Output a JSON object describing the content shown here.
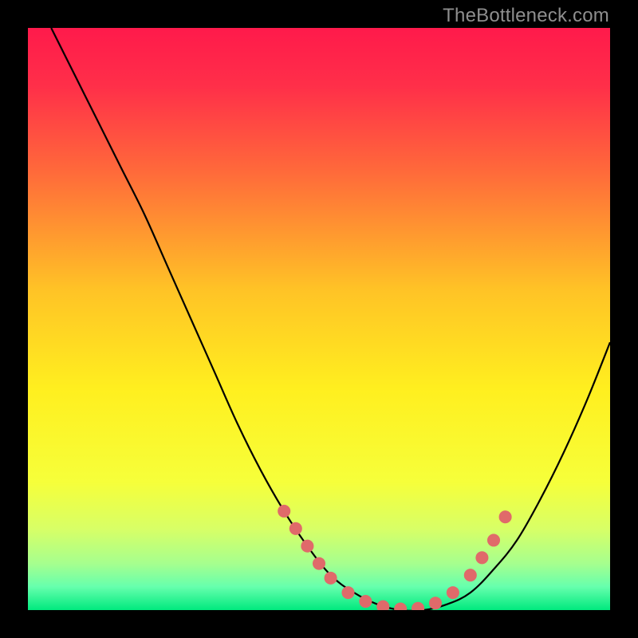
{
  "attribution": "TheBottleneck.com",
  "chart_data": {
    "type": "line",
    "title": "",
    "xlabel": "",
    "ylabel": "",
    "xlim": [
      0,
      100
    ],
    "ylim": [
      0,
      100
    ],
    "gradient_stops": [
      {
        "offset": 0.0,
        "color": "#ff1a4b"
      },
      {
        "offset": 0.1,
        "color": "#ff2f49"
      },
      {
        "offset": 0.25,
        "color": "#ff6b3a"
      },
      {
        "offset": 0.45,
        "color": "#ffc326"
      },
      {
        "offset": 0.62,
        "color": "#ffef1f"
      },
      {
        "offset": 0.78,
        "color": "#f6ff3a"
      },
      {
        "offset": 0.86,
        "color": "#d8ff66"
      },
      {
        "offset": 0.92,
        "color": "#a6ff8e"
      },
      {
        "offset": 0.96,
        "color": "#66ffad"
      },
      {
        "offset": 1.0,
        "color": "#00e97e"
      }
    ],
    "series": [
      {
        "name": "bottleneck-curve",
        "x": [
          4,
          8,
          12,
          16,
          20,
          24,
          28,
          32,
          36,
          40,
          44,
          48,
          52,
          56,
          60,
          64,
          68,
          72,
          76,
          80,
          84,
          88,
          92,
          96,
          100
        ],
        "y": [
          100,
          92,
          84,
          76,
          68,
          59,
          50,
          41,
          32,
          24,
          17,
          11,
          6,
          3,
          1,
          0,
          0,
          1,
          3,
          7,
          12,
          19,
          27,
          36,
          46
        ]
      }
    ],
    "markers": {
      "name": "highlighted-range",
      "color": "#e06a6a",
      "radius_pct": 1.1,
      "points": [
        {
          "x": 44,
          "y": 17
        },
        {
          "x": 46,
          "y": 14
        },
        {
          "x": 48,
          "y": 11
        },
        {
          "x": 50,
          "y": 8
        },
        {
          "x": 52,
          "y": 5.5
        },
        {
          "x": 55,
          "y": 3
        },
        {
          "x": 58,
          "y": 1.5
        },
        {
          "x": 61,
          "y": 0.6
        },
        {
          "x": 64,
          "y": 0.2
        },
        {
          "x": 67,
          "y": 0.3
        },
        {
          "x": 70,
          "y": 1.2
        },
        {
          "x": 73,
          "y": 3
        },
        {
          "x": 76,
          "y": 6
        },
        {
          "x": 78,
          "y": 9
        },
        {
          "x": 80,
          "y": 12
        },
        {
          "x": 82,
          "y": 16
        }
      ]
    }
  }
}
